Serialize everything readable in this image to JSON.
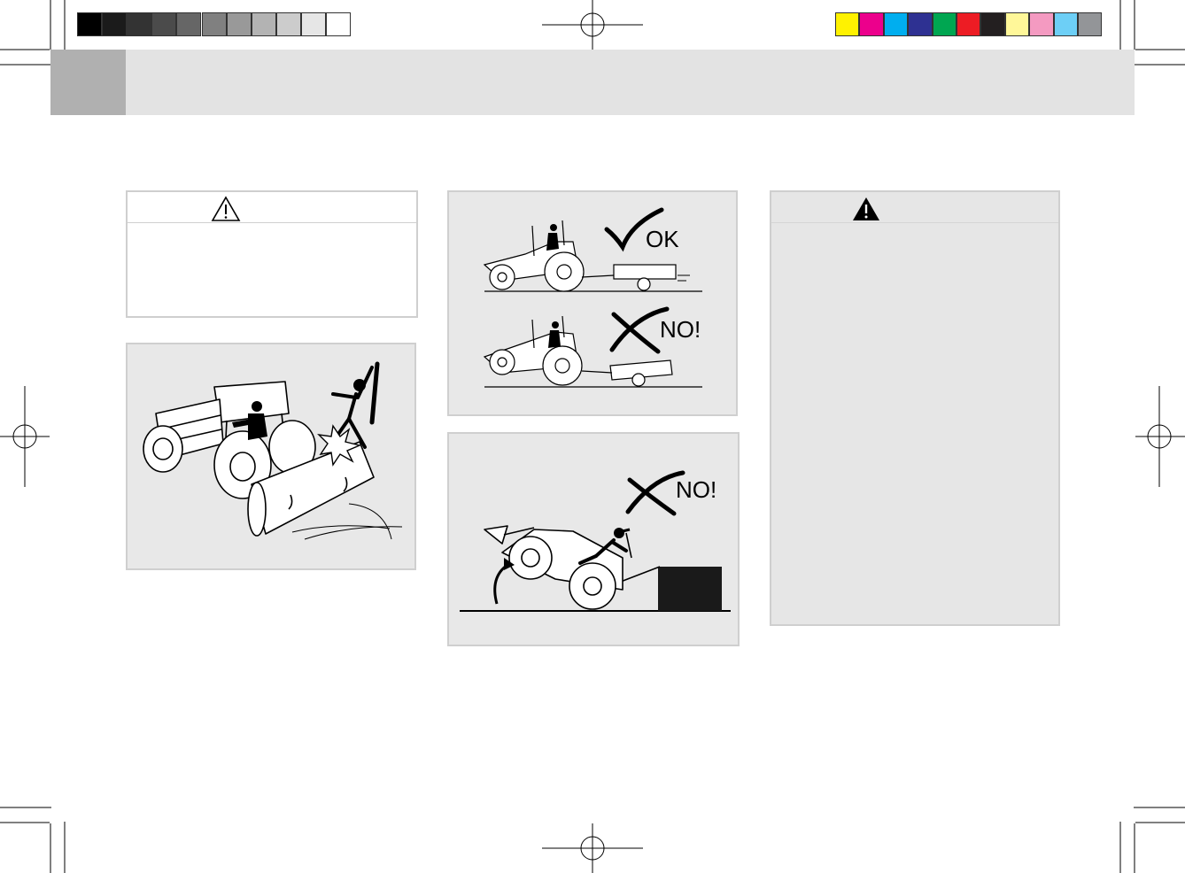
{
  "color_bar": {
    "grayscale": [
      "#000000",
      "#1b1b1b",
      "#333333",
      "#4b4b4b",
      "#666666",
      "#808080",
      "#999999",
      "#b3b3b3",
      "#cccccc",
      "#e6e6e6",
      "#ffffff"
    ],
    "process": [
      "#fff200",
      "#ec008c",
      "#00aeef",
      "#2e3192",
      "#00a651",
      "#ed1c24",
      "#231f20",
      "#fff799",
      "#f49ac1",
      "#6dcff6",
      "#939598"
    ]
  },
  "caution_box": {
    "icon": "warning-triangle-outline-icon"
  },
  "warning_box": {
    "icon": "warning-triangle-filled-icon"
  },
  "figures": {
    "tractor_tiller_hazard": {
      "icon": "tractor-tiller-hazard-illustration"
    },
    "towing_comparison": {
      "ok_label": "OK",
      "no_label": "NO!"
    },
    "loader_tipping": {
      "no_label": "NO!"
    }
  }
}
